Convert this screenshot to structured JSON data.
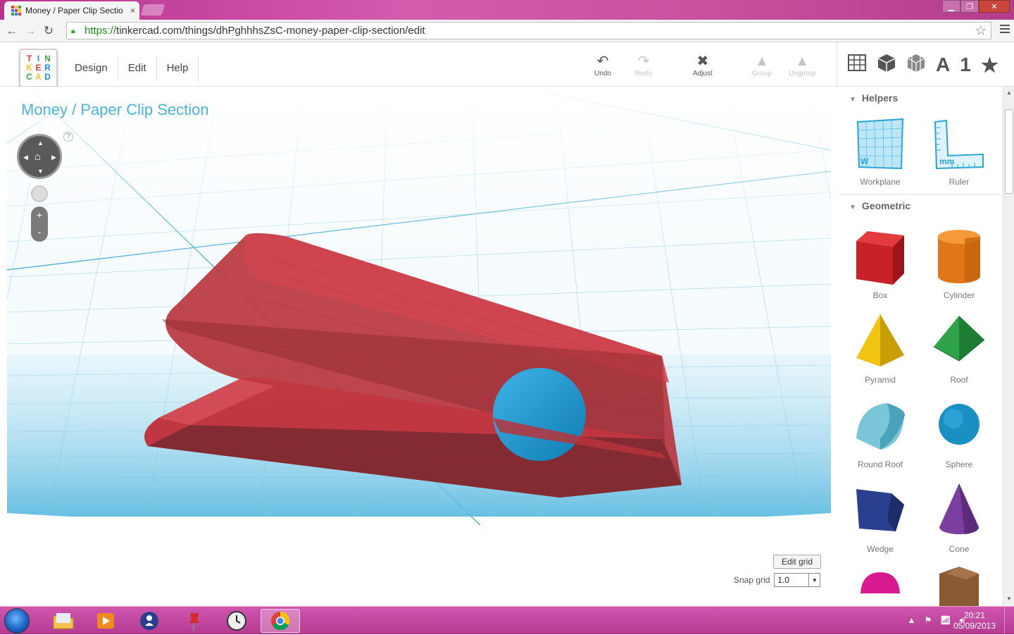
{
  "browser": {
    "tab_title": "Money / Paper Clip Sectio",
    "tab_close": "×",
    "url_scheme": "https://",
    "url_rest": "tinkercad.com/things/dhPghhhsZsC-money-paper-clip-section/edit"
  },
  "app": {
    "logo_letters": [
      "T",
      "I",
      "N",
      "K",
      "E",
      "R",
      "C",
      "A",
      "D"
    ],
    "menu": [
      "Design",
      "Edit",
      "Help"
    ],
    "tools": {
      "undo": "Undo",
      "redo": "Redo",
      "adjust": "Adjust",
      "group": "Group",
      "ungroup": "Ungroup"
    },
    "view_icons": {
      "letter": "A",
      "number": "1",
      "star": "★"
    }
  },
  "canvas": {
    "design_title": "Money / Paper Clip Section",
    "help": "?",
    "zoom_in": "+",
    "zoom_out": "-",
    "edit_grid": "Edit grid",
    "snap_label": "Snap grid",
    "snap_value": "1.0"
  },
  "sidebar": {
    "sections": [
      {
        "title": "Helpers",
        "items": [
          "Workplane",
          "Ruler"
        ]
      },
      {
        "title": "Geometric",
        "items": [
          "Box",
          "Cylinder",
          "Pyramid",
          "Roof",
          "Round Roof",
          "Sphere",
          "Wedge",
          "Cone"
        ]
      }
    ],
    "workplane_mark": "W",
    "ruler_mark": "mm"
  },
  "taskbar": {
    "time": "20:21",
    "date": "05/09/2013"
  },
  "colors": {
    "accent": "#4ab4d8",
    "shape_red": "#c8323c",
    "sphere_blue": "#1a8fc4",
    "taskbar": "#c046a0"
  }
}
